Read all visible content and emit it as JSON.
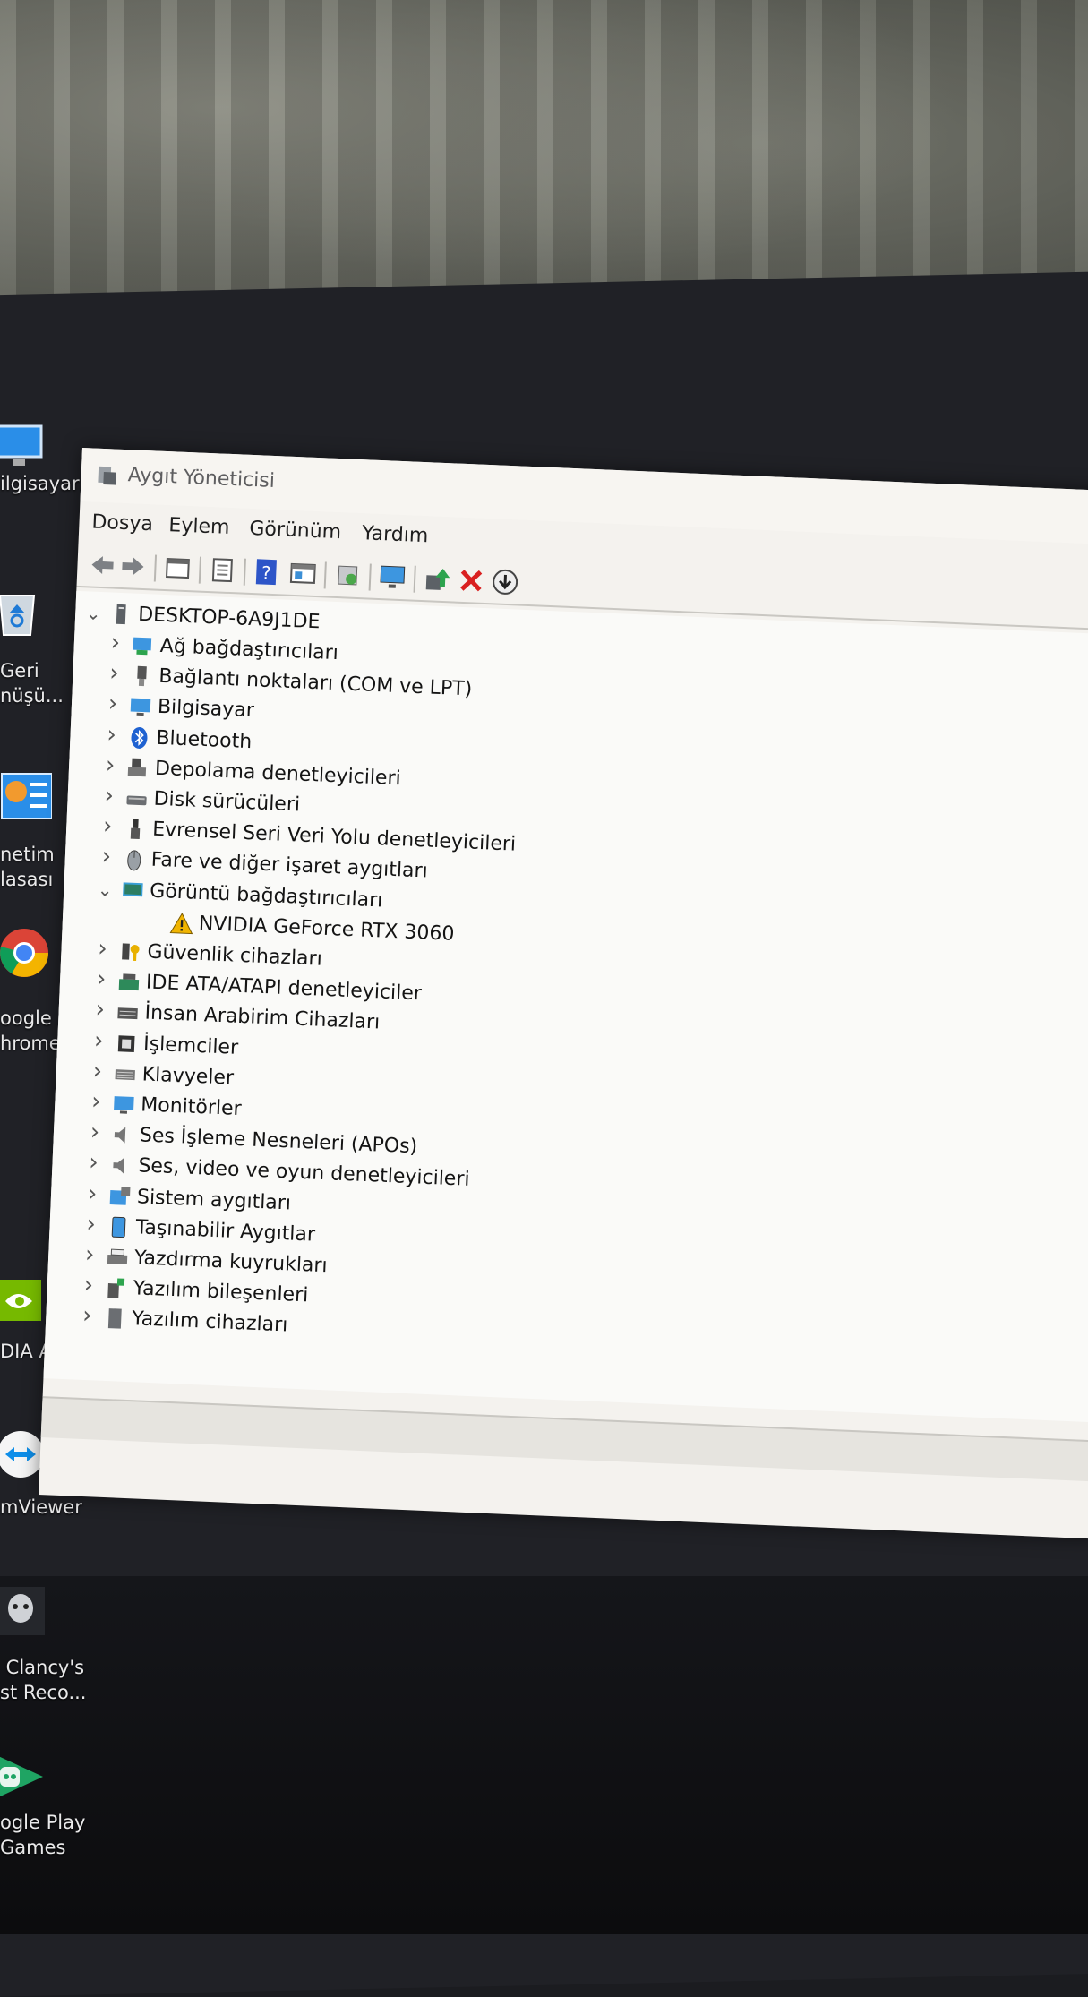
{
  "window": {
    "title": "Aygıt Yöneticisi",
    "menu": [
      "Dosya",
      "Eylem",
      "Görünüm",
      "Yardım"
    ]
  },
  "toolbar": {
    "buttons": [
      "back-icon",
      "forward-icon",
      "properties-icon",
      "list-icon",
      "help-icon",
      "view-icon",
      "scan-icon",
      "monitor-icon",
      "update-driver-icon",
      "uninstall-icon",
      "download-icon"
    ]
  },
  "tree": {
    "root": "DESKTOP-6A9J1DE",
    "items": [
      {
        "label": "Ağ bağdaştırıcıları",
        "icon": "network-adapter-icon",
        "expanded": false
      },
      {
        "label": "Bağlantı noktaları (COM ve LPT)",
        "icon": "port-icon",
        "expanded": false
      },
      {
        "label": "Bilgisayar",
        "icon": "computer-icon",
        "expanded": false
      },
      {
        "label": "Bluetooth",
        "icon": "bluetooth-icon",
        "expanded": false
      },
      {
        "label": "Depolama denetleyicileri",
        "icon": "storage-controller-icon",
        "expanded": false
      },
      {
        "label": "Disk sürücüleri",
        "icon": "disk-drive-icon",
        "expanded": false
      },
      {
        "label": "Evrensel Seri Veri Yolu denetleyicileri",
        "icon": "usb-icon",
        "expanded": false
      },
      {
        "label": "Fare ve diğer işaret aygıtları",
        "icon": "mouse-icon",
        "expanded": false
      },
      {
        "label": "Görüntü bağdaştırıcıları",
        "icon": "display-adapter-icon",
        "expanded": true
      },
      {
        "label": "NVIDIA GeForce RTX 3060",
        "icon": "warning-icon",
        "child": true
      },
      {
        "label": "Güvenlik cihazları",
        "icon": "security-device-icon",
        "expanded": false
      },
      {
        "label": "IDE ATA/ATAPI denetleyiciler",
        "icon": "ide-controller-icon",
        "expanded": false
      },
      {
        "label": "İnsan Arabirim Cihazları",
        "icon": "hid-icon",
        "expanded": false
      },
      {
        "label": "İşlemciler",
        "icon": "processor-icon",
        "expanded": false
      },
      {
        "label": "Klavyeler",
        "icon": "keyboard-icon",
        "expanded": false
      },
      {
        "label": "Monitörler",
        "icon": "monitor-icon",
        "expanded": false
      },
      {
        "label": "Ses İşleme Nesneleri (APOs)",
        "icon": "audio-icon",
        "expanded": false
      },
      {
        "label": "Ses, video ve oyun denetleyicileri",
        "icon": "audio-icon",
        "expanded": false
      },
      {
        "label": "Sistem aygıtları",
        "icon": "system-device-icon",
        "expanded": false
      },
      {
        "label": "Taşınabilir Aygıtlar",
        "icon": "portable-device-icon",
        "expanded": false
      },
      {
        "label": "Yazdırma kuyrukları",
        "icon": "printer-icon",
        "expanded": false
      },
      {
        "label": "Yazılım bileşenleri",
        "icon": "software-component-icon",
        "expanded": false
      },
      {
        "label": "Yazılım cihazları",
        "icon": "software-device-icon",
        "expanded": false
      }
    ]
  },
  "desktop": {
    "icons": [
      {
        "label": "ilgisayar",
        "icon": "this-pc-icon"
      },
      {
        "label": "Geri\nnüşü...",
        "icon": "recycle-bin-icon"
      },
      {
        "label": "netim\nlasası",
        "icon": "control-panel-icon"
      },
      {
        "label": "oogle\nhrome",
        "icon": "chrome-icon"
      },
      {
        "label": "DIA App",
        "icon": "nvidia-icon"
      },
      {
        "label": "mViewer",
        "icon": "teamviewer-icon"
      },
      {
        "label": " Clancy's\nst Reco...",
        "icon": "ghost-recon-icon"
      },
      {
        "label": "ogle Play\nGames",
        "icon": "google-play-games-icon"
      }
    ]
  },
  "colors": {
    "window_bg": "#f4f2ee",
    "desktop_bg": "#1b1c20",
    "warning": "#f0b400",
    "uninstall_red": "#d92020",
    "accent_blue": "#1f7ad1"
  }
}
